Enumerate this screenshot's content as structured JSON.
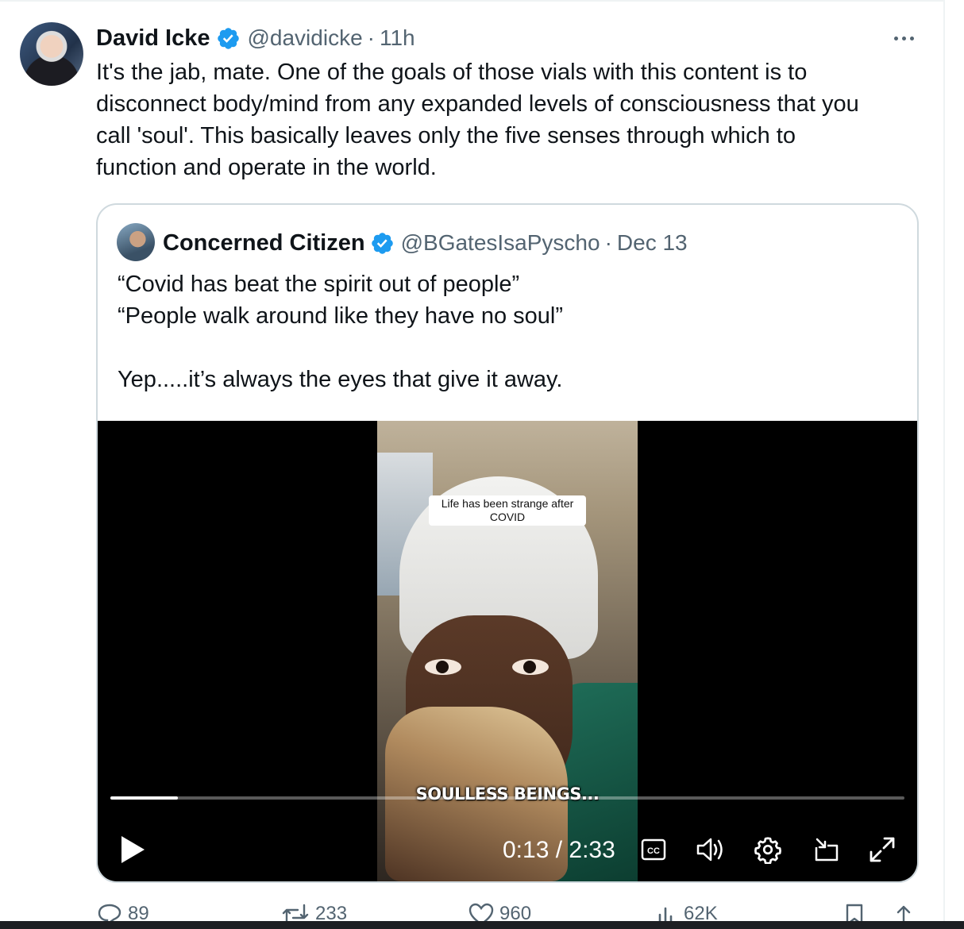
{
  "tweet": {
    "author_name": "David Icke",
    "handle": "@davidicke",
    "separator": "·",
    "time": "11h",
    "text": "It's the jab, mate. One of the goals of those vials with this content is to\ndisconnect body/mind from any expanded levels of consciousness that you\ncall 'soul'. This basically leaves only the five senses through which to\nfunction and operate in the world."
  },
  "quoted": {
    "author_name": "Concerned Citizen",
    "handle": "@BGatesIsaPyscho",
    "separator": "·",
    "time": "Dec 13",
    "text": "“Covid has beat the spirit out of people”\n“People walk around like they have no soul”\n\nYep.....it’s always the eyes that give it away."
  },
  "video": {
    "caption_top": "Life has been strange after COVID",
    "caption_bottom": "SOULLESS BEINGS...",
    "current_time": "0:13",
    "duration": "2:33",
    "time_display": "0:13 / 2:33",
    "progress": 0.085,
    "cc_label": "CC"
  },
  "actions": {
    "replies": "89",
    "retweets": "233",
    "likes": "960",
    "views": "62K"
  },
  "colors": {
    "verified": "#1d9bf0",
    "secondary_text": "#536471",
    "border": "#cfd9de"
  }
}
